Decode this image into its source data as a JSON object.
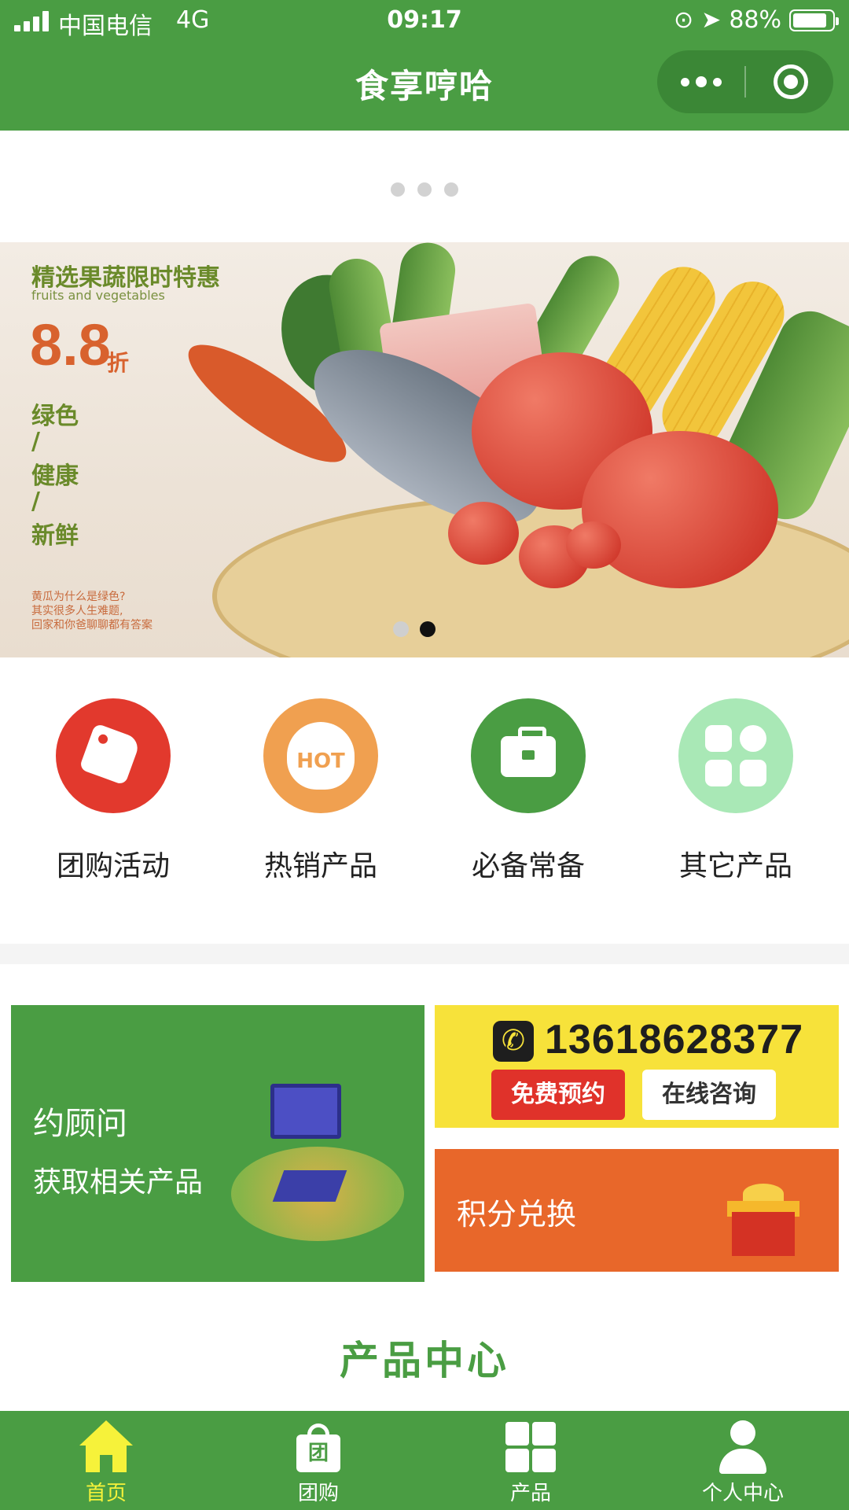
{
  "status_bar": {
    "carrier": "中国电信",
    "network": "4G",
    "time": "09:17",
    "battery": "88%",
    "battery_level": 0.88
  },
  "nav": {
    "title": "食享哼哈",
    "more_icon": "more-dots-icon",
    "close_icon": "target-close-icon"
  },
  "banner": {
    "headline": "精选果蔬限时特惠",
    "subheadline": "fruits and vegetables",
    "discount": "8.8",
    "discount_unit": "折",
    "words": [
      "绿色",
      "/",
      "健康",
      "/",
      "新鲜"
    ],
    "note_lines": [
      "黄瓜为什么是绿色?",
      "其实很多人生难题,",
      "回家和你爸聊聊都有答案"
    ],
    "active_slide": 2,
    "slide_count": 2
  },
  "categories": [
    {
      "label": "团购活动",
      "icon": "tag-icon",
      "color": "#e2392d"
    },
    {
      "label": "热销产品",
      "icon": "hot-flame-icon",
      "color": "#f0a050",
      "icon_text": "HOT"
    },
    {
      "label": "必备常备",
      "icon": "briefcase-icon",
      "color": "#4a9d43"
    },
    {
      "label": "其它产品",
      "icon": "apps-grid-icon",
      "color": "#a9e8b6"
    }
  ],
  "promos": {
    "consultant": {
      "line1": "约顾问",
      "line2": "获取相关产品"
    },
    "contact": {
      "phone": "13618628377",
      "free_booking": "免费预约",
      "online_consult": "在线咨询"
    },
    "points": {
      "label": "积分兑换"
    }
  },
  "section_title": "产品中心",
  "tabbar": [
    {
      "label": "首页",
      "icon": "home-icon",
      "active": true
    },
    {
      "label": "团购",
      "icon": "shopping-bag-icon",
      "active": false,
      "icon_text": "团"
    },
    {
      "label": "产品",
      "icon": "grid-icon",
      "active": false
    },
    {
      "label": "个人中心",
      "icon": "user-icon",
      "active": false
    }
  ],
  "colors": {
    "primary": "#4a9d43",
    "active_tab": "#f6f23a",
    "points_orange": "#e8672a",
    "contact_yellow": "#f7e23a"
  }
}
